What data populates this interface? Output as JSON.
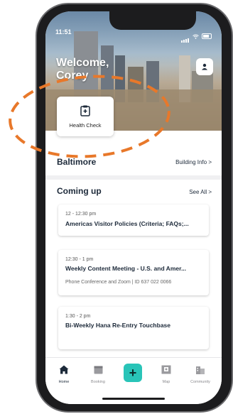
{
  "status_bar": {
    "time": "11:51"
  },
  "header": {
    "welcome_line1": "Welcome,",
    "welcome_line2": "Corey"
  },
  "quick_actions": [
    {
      "label": "Health Check",
      "icon": "clipboard-health-icon"
    }
  ],
  "location": {
    "name": "Baltimore",
    "link": "Building Info >"
  },
  "upcoming": {
    "title": "Coming up",
    "see_all": "See All >",
    "events": [
      {
        "time": "12 - 12:30 pm",
        "title": "Americas Visitor Policies (Criteria; FAQs;...",
        "location": ""
      },
      {
        "time": "12:30 - 1 pm",
        "title": "Weekly Content Meeting - U.S. and Amer...",
        "location": "Phone Conference and Zoom | ID 637 022 0066"
      },
      {
        "time": "1:30 - 2 pm",
        "title": "Bi-Weekly Hana Re-Entry Touchbase",
        "location": ""
      }
    ]
  },
  "tabbar": {
    "items": [
      {
        "label": "Home",
        "icon": "home-icon",
        "active": true
      },
      {
        "label": "Booking",
        "icon": "calendar-icon"
      },
      {
        "label": "",
        "icon": "plus-icon"
      },
      {
        "label": "Map",
        "icon": "map-icon"
      },
      {
        "label": "Community",
        "icon": "community-icon"
      }
    ]
  },
  "colors": {
    "accent": "#29c4b8",
    "text_primary": "#1d2a3a",
    "annotation": "#e8782a"
  }
}
